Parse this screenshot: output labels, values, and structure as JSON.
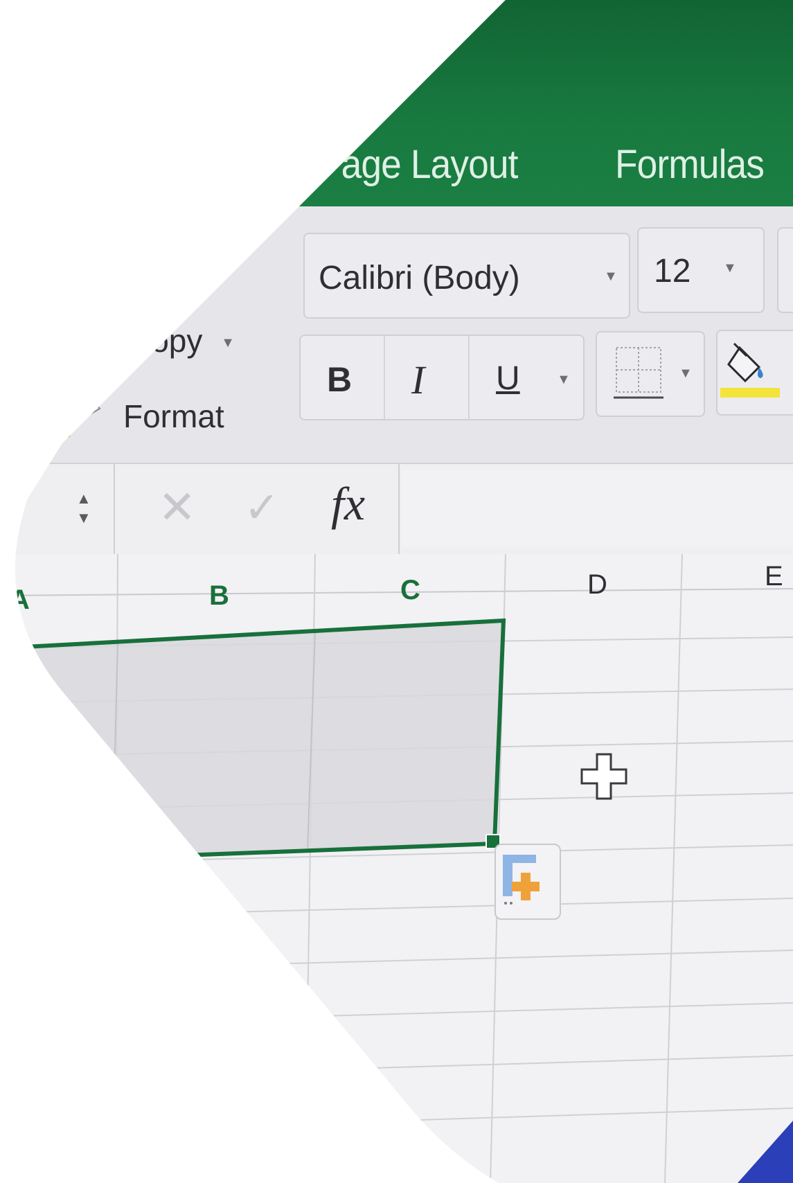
{
  "ribbon": {
    "tabs": [
      {
        "label": "Page Layout"
      },
      {
        "label": "Formulas"
      }
    ],
    "color": "#17763d"
  },
  "clipboard": {
    "copy_label": "Copy",
    "format_label": "Format"
  },
  "font": {
    "family_value": "Calibri (Body)",
    "size_value": "12",
    "bold_label": "B",
    "italic_label": "I",
    "underline_label": "U"
  },
  "formula_bar": {
    "fx_label": "fx"
  },
  "sheet": {
    "columns": [
      "A",
      "B",
      "C",
      "D",
      "E"
    ],
    "selection_color": "#18703b"
  }
}
